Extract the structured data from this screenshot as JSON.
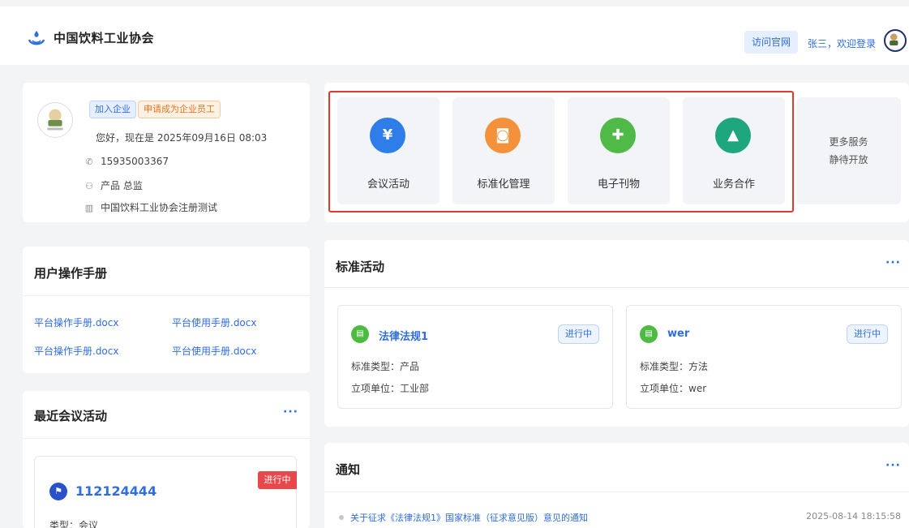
{
  "header": {
    "brand": "中国饮料工业协会",
    "visit_site": "访问官网",
    "welcome": "张三，欢迎登录"
  },
  "profile": {
    "tag_join": "加入企业",
    "tag_apply": "申请成为企业员工",
    "greeting": "您好，现在是 2025年09月16日 08:03",
    "phone": "15935003367",
    "position": "产品 总监",
    "company": "中国饮料工业协会注册测试"
  },
  "manual": {
    "title": "用户操作手册",
    "docs": [
      "平台操作手册.docx",
      "平台使用手册.docx",
      "平台操作手册.docx",
      "平台使用手册.docx"
    ]
  },
  "meetings": {
    "title": "最近会议活动",
    "more": "···",
    "item": {
      "title": "112124444",
      "status": "进行中",
      "type": "类型：会议"
    }
  },
  "services": {
    "items": [
      {
        "label": "会议活动",
        "icon": "yen-icon",
        "glyph": "¥",
        "color": "#2f7de8"
      },
      {
        "label": "标准化管理",
        "icon": "camera-icon",
        "glyph": "◙",
        "color": "#f3923a"
      },
      {
        "label": "电子刊物",
        "icon": "plus-icon",
        "glyph": "✚",
        "color": "#4fba47"
      },
      {
        "label": "业务合作",
        "icon": "graduation-cap-icon",
        "glyph": "▲",
        "color": "#1ea77e"
      }
    ],
    "more_line1": "更多服务",
    "more_line2": "静待开放"
  },
  "standards": {
    "title": "标准活动",
    "more": "···",
    "items": [
      {
        "name": "法律法规1",
        "status": "进行中",
        "type": "标准类型：产品",
        "unit": "立项单位：工业部"
      },
      {
        "name": "wer",
        "status": "进行中",
        "type": "标准类型：方法",
        "unit": "立项单位：wer"
      }
    ]
  },
  "notice": {
    "title": "通知",
    "more": "···",
    "item": {
      "text": "关于征求《法律法规1》国家标准（征求意见版）意见的通知",
      "date": "2025-08-14 18:15:58"
    }
  },
  "colors": {
    "primary": "#2f6de1",
    "highlight_border": "#e03b2e",
    "status_red": "#e8474c"
  }
}
